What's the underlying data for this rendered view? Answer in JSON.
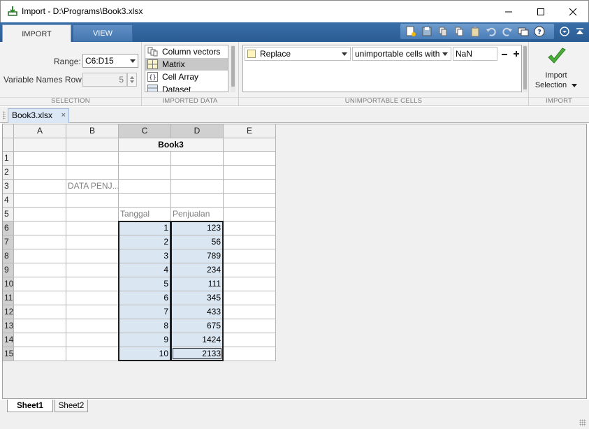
{
  "window": {
    "title": "Import - D:\\Programs\\Book3.xlsx",
    "minimize_icon": "minimize-icon",
    "maximize_icon": "maximize-icon",
    "close_icon": "close-icon"
  },
  "ribbon": {
    "tabs": [
      {
        "label": "IMPORT",
        "active": true
      },
      {
        "label": "VIEW",
        "active": false
      }
    ],
    "selection": {
      "range_label": "Range:",
      "range_value": "C6:D15",
      "var_names_label": "Variable Names Row:",
      "var_names_value": "5",
      "section_label": "SELECTION"
    },
    "imported_data": {
      "items": [
        {
          "label": "Column vectors",
          "selected": false
        },
        {
          "label": "Matrix",
          "selected": true
        },
        {
          "label": "Cell Array",
          "selected": false
        },
        {
          "label": "Dataset",
          "selected": false
        }
      ],
      "section_label": "IMPORTED DATA"
    },
    "unimportable": {
      "action": "Replace",
      "condition": "unimportable cells with",
      "value": "NaN",
      "section_label": "UNIMPORTABLE CELLS"
    },
    "import": {
      "label_line1": "Import",
      "label_line2": "Selection",
      "section_label": "IMPORT"
    }
  },
  "document_tab": {
    "label": "Book3.xlsx",
    "close": "×"
  },
  "sheet": {
    "columns": [
      "A",
      "B",
      "C",
      "D",
      "E"
    ],
    "rows": [
      "1",
      "2",
      "3",
      "4",
      "5",
      "6",
      "7",
      "8",
      "9",
      "10",
      "11",
      "12",
      "13",
      "14",
      "15"
    ],
    "var_name_header": "Book3",
    "cells": {
      "B3": "DATA PENJ...",
      "C5": "Tanggal",
      "D5": "Penjualan"
    },
    "data": {
      "C": [
        "1",
        "2",
        "3",
        "4",
        "5",
        "6",
        "7",
        "8",
        "9",
        "10"
      ],
      "D": [
        "123",
        "56",
        "789",
        "234",
        "111",
        "345",
        "433",
        "675",
        "1424",
        "2133"
      ]
    }
  },
  "sheet_tabs": [
    {
      "label": "Sheet1",
      "active": true
    },
    {
      "label": "Sheet2",
      "active": false
    }
  ]
}
